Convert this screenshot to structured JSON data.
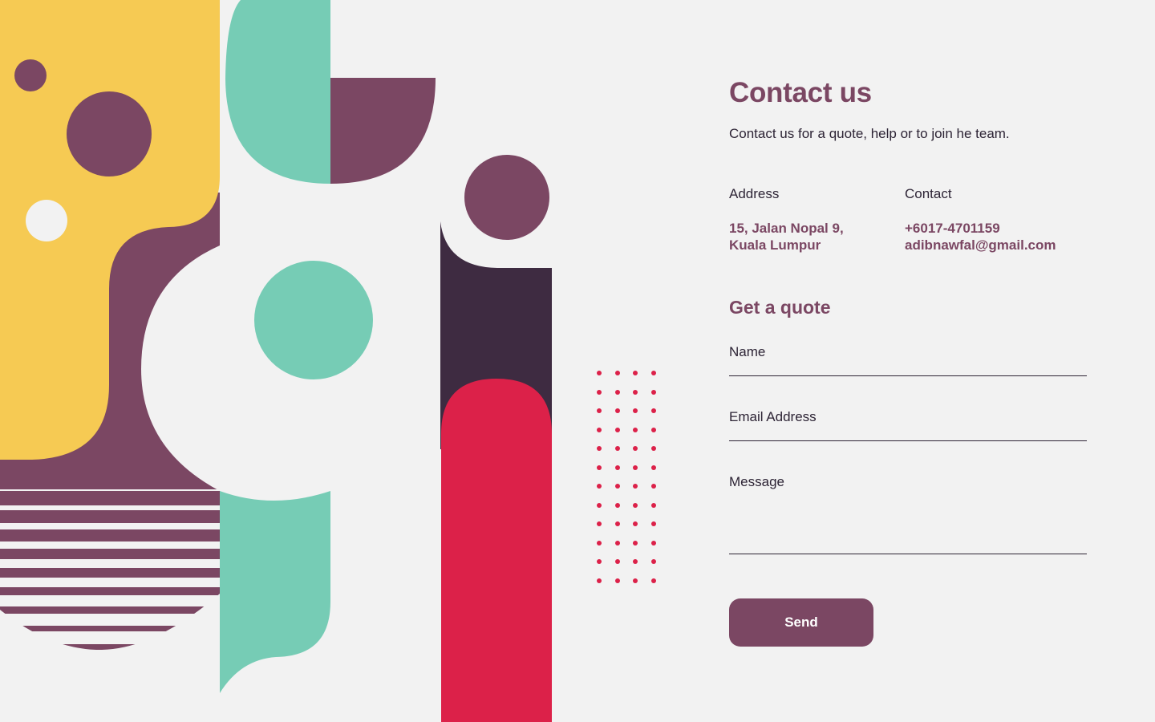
{
  "colors": {
    "background": "#f2f2f2",
    "plum": "#7b4763",
    "dark_plum": "#3e2b41",
    "mustard": "#f6ca53",
    "mint": "#76ccb5",
    "crimson": "#dc2149",
    "text": "#2d2435"
  },
  "contact": {
    "title": "Contact us",
    "subtitle": "Contact us for a quote, help or to join he team.",
    "address_label": "Address",
    "address_line1": "15, Jalan Nopal 9,",
    "address_line2": "Kuala Lumpur",
    "contact_label": "Contact",
    "phone": "+6017-4701159",
    "email": "adibnawfal@gmail.com"
  },
  "quote": {
    "title": "Get a quote",
    "name_label": "Name",
    "email_label": "Email Address",
    "message_label": "Message",
    "send_label": "Send"
  }
}
